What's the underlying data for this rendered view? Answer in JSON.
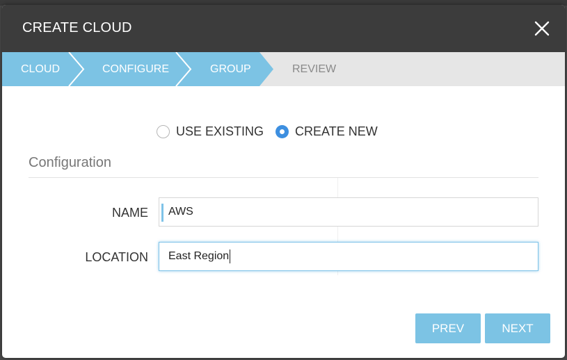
{
  "modal": {
    "title": "CREATE CLOUD"
  },
  "wizard": {
    "steps": [
      {
        "label": "CLOUD",
        "state": "completed"
      },
      {
        "label": "CONFIGURE",
        "state": "completed"
      },
      {
        "label": "GROUP",
        "state": "current"
      },
      {
        "label": "REVIEW",
        "state": "upcoming"
      }
    ],
    "colors": {
      "active": "#7cc3e4",
      "inactive": "#e6e6e6"
    }
  },
  "mode": {
    "options": [
      {
        "label": "USE EXISTING",
        "checked": false
      },
      {
        "label": "CREATE NEW",
        "checked": true
      }
    ]
  },
  "section": {
    "title": "Configuration"
  },
  "fields": {
    "name": {
      "label": "NAME",
      "value": "AWS"
    },
    "location": {
      "label": "LOCATION",
      "value": "East Region"
    }
  },
  "buttons": {
    "prev": "PREV",
    "next": "NEXT"
  }
}
